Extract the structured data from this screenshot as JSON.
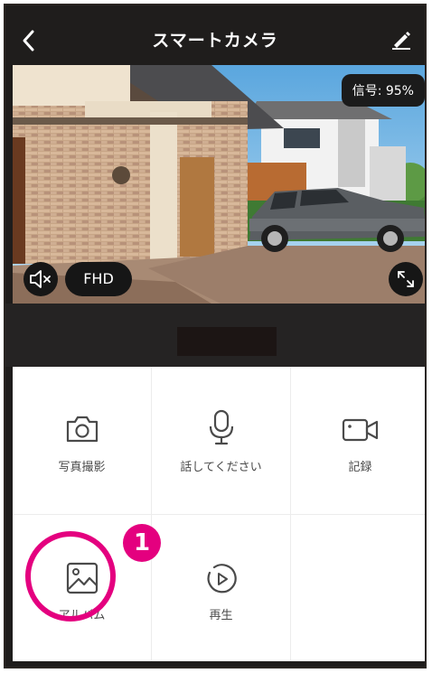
{
  "header": {
    "title": "スマートカメラ",
    "back_icon": "chevron-left-icon",
    "edit_icon": "pencil-icon"
  },
  "camera": {
    "signal_label": "信号: 95%",
    "quality_label": "FHD",
    "mute_icon": "speaker-muted-icon",
    "fullscreen_icon": "fullscreen-icon"
  },
  "controls": [
    {
      "label": "写真撮影",
      "icon": "camera-icon"
    },
    {
      "label": "話してください",
      "icon": "microphone-icon"
    },
    {
      "label": "記録",
      "icon": "video-camera-icon"
    },
    {
      "label": "アルバム",
      "icon": "image-icon"
    },
    {
      "label": "再生",
      "icon": "playback-icon"
    }
  ],
  "annotation": {
    "step_number": "1",
    "highlight_color": "#e4007f"
  }
}
